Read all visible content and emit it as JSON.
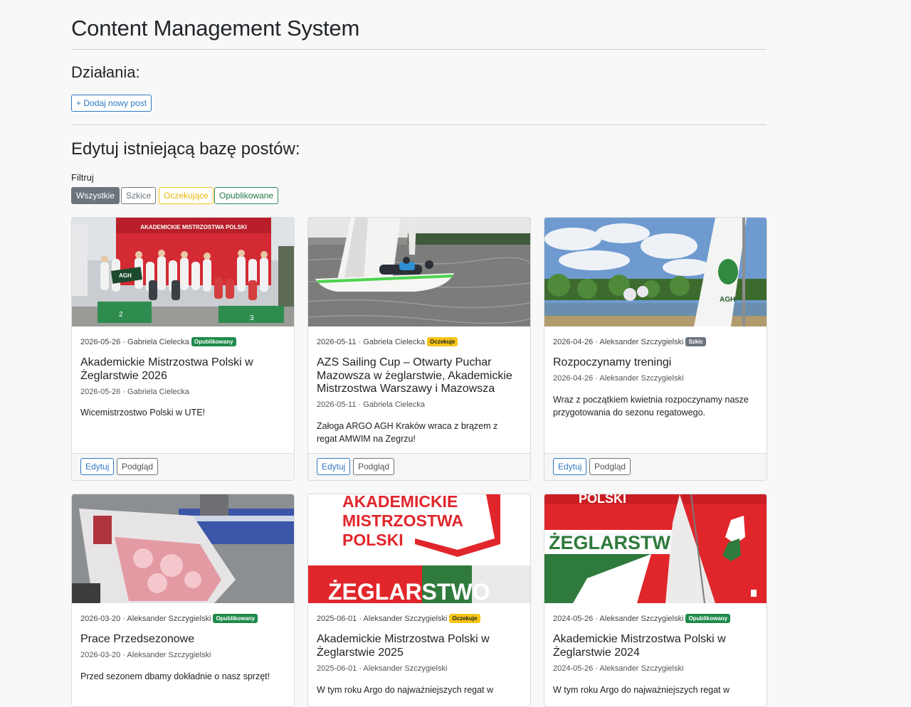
{
  "header": {
    "title": "Content Management System"
  },
  "actions": {
    "heading": "Działania:",
    "add_label": "+ Dodaj nowy post"
  },
  "editor": {
    "heading": "Edytuj istniejącą bazę postów:"
  },
  "filter": {
    "label": "Filtruj",
    "options": [
      "Wszystkie",
      "Szkice",
      "Oczekujące",
      "Opublikowane"
    ]
  },
  "card_buttons": {
    "edit": "Edytuj",
    "preview": "Podgląd"
  },
  "posts": [
    {
      "meta": "2026-05-26 · Gabriela Cielecka",
      "status": "Opublikowany",
      "title": "Akademickie Mistrzostwa Polski w Żeglarstwie 2026",
      "sub": "2026-05-26 · Gabriela Cielecka",
      "excerpt": "Wicemistrzostwo Polski w UTE!",
      "banner": "AKADEMICKIE MISTRZOSTWA POLSKI"
    },
    {
      "meta": "2026-05-11 · Gabriela Cielecka",
      "status": "Oczekuje",
      "title": "AZS Sailing Cup – Otwarty Puchar Mazowsza w żeglarstwie, Akademickie Mistrzostwa Warszawy i Mazowsza",
      "sub": "2026-05-11 · Gabriela Cielecka",
      "excerpt": "Załoga ARGO AGH Kraków wraca z brązem z regat AMWIM na Zegrzu!"
    },
    {
      "meta": "2026-04-26 · Aleksander Szczygielski",
      "status": "Szkic",
      "title": "Rozpoczynamy treningi",
      "sub": "2026-04-26 · Aleksander Szczygielski",
      "excerpt": "Wraz z początkiem kwietnia rozpoczynamy nasze przygotowania do sezonu regatowego."
    },
    {
      "meta": "2026-03-20 · Aleksander Szczygielski",
      "status": "Opublikowany",
      "title": "Prace Przedsezonowe",
      "sub": "2026-03-20 · Aleksander Szczygielski",
      "excerpt": "Przed sezonem dbamy dokładnie o nasz sprzęt!"
    },
    {
      "meta": "2025-06-01 · Aleksander Szczygielski",
      "status": "Oczekuje",
      "title": "Akademickie Mistrzostwa Polski w Żeglarstwie 2025",
      "sub": "2025-06-01 · Aleksander Szczygielski",
      "excerpt": "W tym roku Argo do najważniejszych regat w",
      "graphic": {
        "line1": "AKADEMICKIE",
        "line2": "MISTRZOSTWA",
        "line3": "POLSKI",
        "word": "ŻEGLARSTWO"
      }
    },
    {
      "meta": "2024-05-26 · Aleksander Szczygielski",
      "status": "Opublikowany",
      "title": "Akademickie Mistrzostwa Polski w Żeglarstwie 2024",
      "sub": "2024-05-26 · Aleksander Szczygielski",
      "excerpt": "W tym roku Argo do najważniejszych regat w",
      "graphic": {
        "top": "POLSKI",
        "word": "ŻEGLARSTWO"
      }
    }
  ]
}
